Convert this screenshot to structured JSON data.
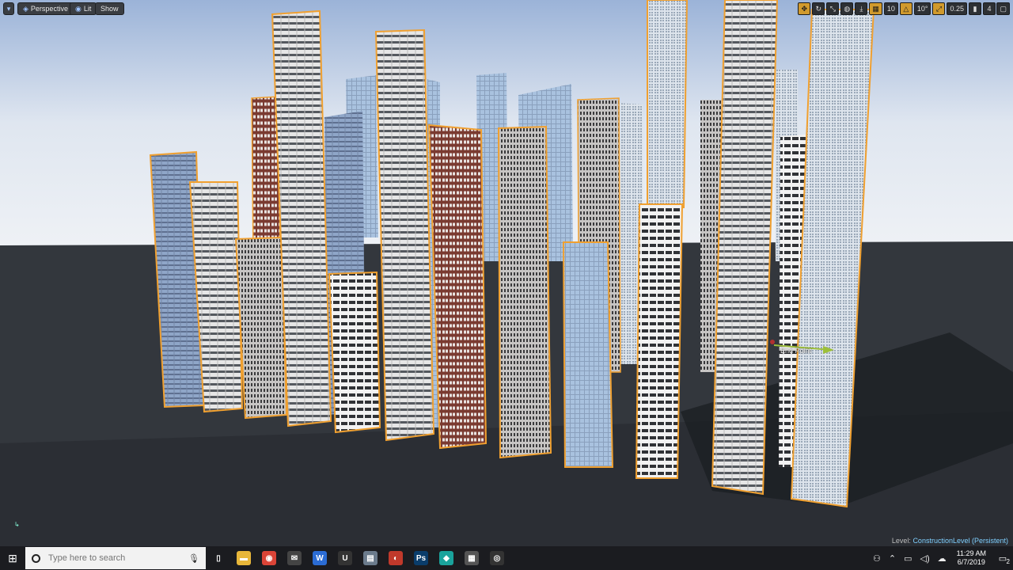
{
  "viewport": {
    "perspective_label": "Perspective",
    "lit_label": "Lit",
    "show_label": "Show",
    "grid_snap_value": "10",
    "rotation_snap_value": "10°",
    "scale_snap_value": "0.25",
    "camera_speed_value": "4",
    "end_point_label": "End Point",
    "level_prefix": "Level:",
    "level_name": "ConstructionLevel (Persistent)"
  },
  "taskbar": {
    "search_placeholder": "Type here to search",
    "clock_time": "11:29 AM",
    "clock_date": "6/7/2019",
    "notification_count": "2",
    "apps": [
      {
        "icon": "task-view-icon",
        "glyph": "▯",
        "color": "#1b1c20"
      },
      {
        "icon": "file-explorer-icon",
        "glyph": "▬",
        "color": "#e8b73a"
      },
      {
        "icon": "chrome-icon",
        "glyph": "◉",
        "color": "#db4437"
      },
      {
        "icon": "mail-icon",
        "glyph": "✉",
        "color": "#444"
      },
      {
        "icon": "word-icon",
        "glyph": "W",
        "color": "#2b6cd4"
      },
      {
        "icon": "unreal-icon",
        "glyph": "U",
        "color": "#333"
      },
      {
        "icon": "files-icon",
        "glyph": "▤",
        "color": "#6b7b8c"
      },
      {
        "icon": "media-icon",
        "glyph": "◐",
        "color": "#c0392b"
      },
      {
        "icon": "photoshop-icon",
        "glyph": "Ps",
        "color": "#0a3d6b"
      },
      {
        "icon": "sketchup-icon",
        "glyph": "◆",
        "color": "#1aa39c"
      },
      {
        "icon": "calculator-icon",
        "glyph": "▦",
        "color": "#555"
      },
      {
        "icon": "obs-icon",
        "glyph": "◎",
        "color": "#333"
      }
    ]
  },
  "colors": {
    "selection_outline": "#f0a030",
    "sky": "#dfe5ee",
    "ground": "#30343a",
    "taskbar": "#1b1c20"
  }
}
